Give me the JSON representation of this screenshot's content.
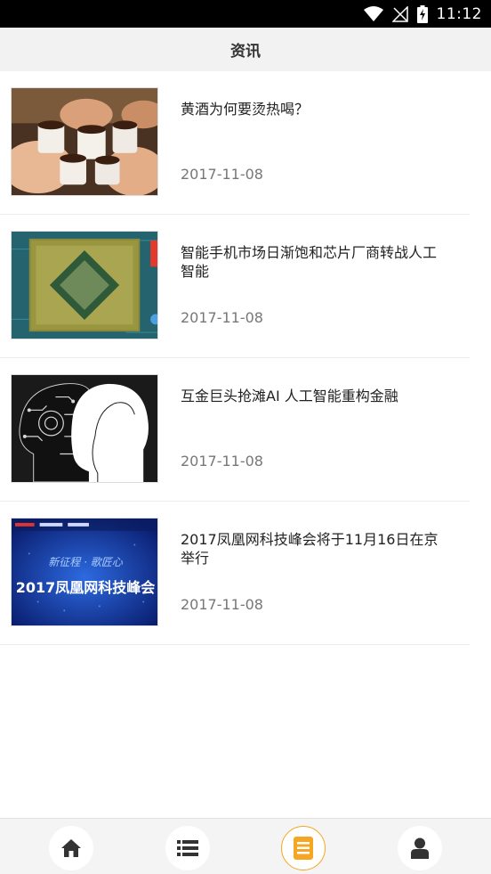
{
  "status_bar": {
    "time": "11:12"
  },
  "header": {
    "title": "资讯"
  },
  "news": [
    {
      "title": "黄酒为何要烫热喝？",
      "date": "2017-11-08",
      "thumb_icon": "toasting-cups-image"
    },
    {
      "title": "智能手机市场日渐饱和芯片厂商转战人工智能",
      "date": "2017-11-08",
      "thumb_icon": "cpu-chip-image"
    },
    {
      "title": "互金巨头抢滩AI 人工智能重构金融",
      "date": "2017-11-08",
      "thumb_icon": "ai-head-image"
    },
    {
      "title": "2017凤凰网科技峰会将于11月16日在京举行",
      "date": "2017-11-08",
      "thumb_icon": "summit-banner-image",
      "thumb_text": {
        "line1": "新征程 · 歌匠心",
        "line2": "2017凤凰网科技峰会"
      }
    }
  ],
  "bottom_nav": {
    "items": [
      {
        "icon": "home-icon",
        "active": false
      },
      {
        "icon": "list-icon",
        "active": false
      },
      {
        "icon": "news-icon",
        "active": true
      },
      {
        "icon": "user-icon",
        "active": false
      }
    ],
    "accent_color": "#f5a623"
  }
}
